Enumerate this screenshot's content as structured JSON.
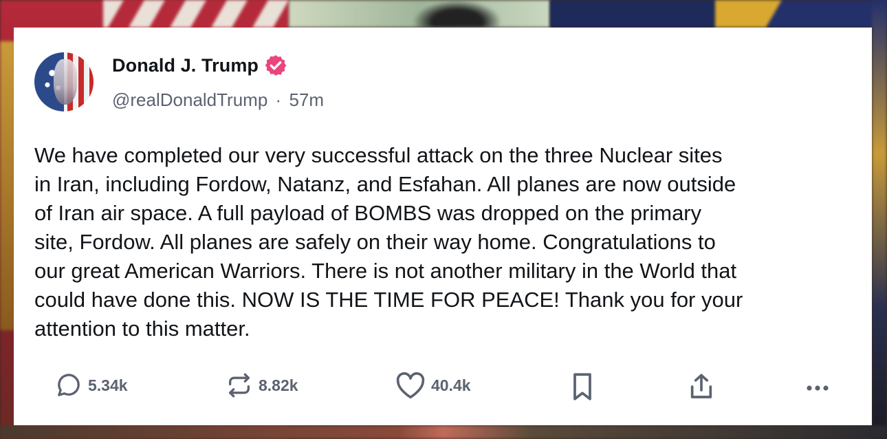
{
  "post": {
    "author_name": "Donald J. Trump",
    "handle": "@realDonaldTrump",
    "separator": "·",
    "time_ago": "57m",
    "text": "We have completed our very successful attack on the three Nuclear sites\nin Iran, including Fordow, Natanz, and Esfahan. All planes are now outside\nof Iran air space. A full payload of BOMBS was dropped on the primary\nsite, Fordow. All planes are safely on their way home. Congratulations to\nour great American Warriors. There is not another military in the World that\ncould have done this. NOW IS THE TIME FOR PEACE! Thank you for your\nattention to this matter.",
    "verified_icon": "verified-badge-icon",
    "verified_color": "#e8467c"
  },
  "actions": {
    "replies": "5.34k",
    "reposts": "8.82k",
    "likes": "40.4k",
    "icons": [
      "comment-icon",
      "repost-icon",
      "heart-icon",
      "bookmark-icon",
      "share-icon",
      "more-icon"
    ]
  },
  "colors": {
    "card_background": "#ffffff",
    "text_primary": "#111418",
    "text_secondary": "#5b6270"
  }
}
